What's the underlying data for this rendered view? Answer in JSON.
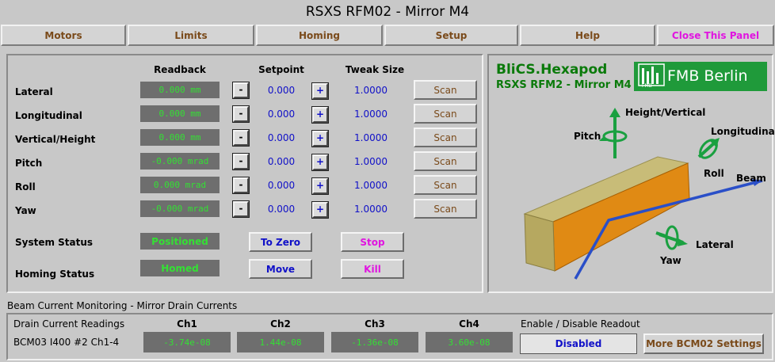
{
  "window": {
    "title": "RSXS RFM02 - Mirror M4"
  },
  "menu": [
    {
      "label": "Motors"
    },
    {
      "label": "Limits"
    },
    {
      "label": "Homing"
    },
    {
      "label": "Setup"
    },
    {
      "label": "Help"
    },
    {
      "label": "Close This Panel"
    }
  ],
  "motors": {
    "headers": {
      "readback": "Readback",
      "setpoint": "Setpoint",
      "tweak": "Tweak Size"
    },
    "minus_label": "-",
    "plus_label": "+",
    "scan_label": "Scan",
    "rows": [
      {
        "name": "Lateral",
        "readback": "0.000 mm",
        "setpoint": "0.000",
        "tweak": "1.0000"
      },
      {
        "name": "Longitudinal",
        "readback": "0.000 mm",
        "setpoint": "0.000",
        "tweak": "1.0000"
      },
      {
        "name": "Vertical/Height",
        "readback": "0.000 mm",
        "setpoint": "0.000",
        "tweak": "1.0000"
      },
      {
        "name": "Pitch",
        "readback": "-0.000 mrad",
        "setpoint": "0.000",
        "tweak": "1.0000"
      },
      {
        "name": "Roll",
        "readback": "0.000 mrad",
        "setpoint": "0.000",
        "tweak": "1.0000"
      },
      {
        "name": "Yaw",
        "readback": "-0.000 mrad",
        "setpoint": "0.000",
        "tweak": "1.0000"
      }
    ]
  },
  "status": {
    "system_label": "System Status",
    "system_value": "Positioned",
    "homing_label": "Homing Status",
    "homing_value": "Homed",
    "to_zero": "To Zero",
    "move": "Move",
    "stop": "Stop",
    "kill": "Kill"
  },
  "diagram": {
    "title": "BliCS.Hexapod",
    "subtitle": "RSXS RFM2 - Mirror M4",
    "logo_text": "FMB Berlin",
    "logo_small": "FMB",
    "labels": {
      "height": "Height/Vertical",
      "pitch": "Pitch",
      "longitudinal": "Longitudinal",
      "roll": "Roll",
      "beam": "Beam",
      "lateral": "Lateral",
      "yaw": "Yaw"
    }
  },
  "beam_current": {
    "section_title": "Beam Current Monitoring - Mirror Drain Currents",
    "readings_label": "Drain Current Readings",
    "device_label": "BCM03 I400 #2 Ch1-4",
    "channels": [
      {
        "name": "Ch1",
        "value": "-3.74e-08"
      },
      {
        "name": "Ch2",
        "value": "1.44e-08"
      },
      {
        "name": "Ch3",
        "value": "-1.36e-08"
      },
      {
        "name": "Ch4",
        "value": "3.60e-08"
      }
    ],
    "enable_label": "Enable / Disable Readout",
    "enable_value": "Disabled",
    "more_settings": "More BCM02 Settings"
  },
  "colors": {
    "background": "#c8c8c8",
    "readback_bg": "#6e6e6e",
    "readback_text": "#34e034",
    "value_blue": "#1010c8",
    "button_brown": "#7a4a1a",
    "magenta": "#e015e0",
    "diagram_green": "#0a7a0a",
    "logo_green": "#1f9a3a",
    "mirror_orange": "#e08a14",
    "mirror_top": "#c8bc78"
  }
}
